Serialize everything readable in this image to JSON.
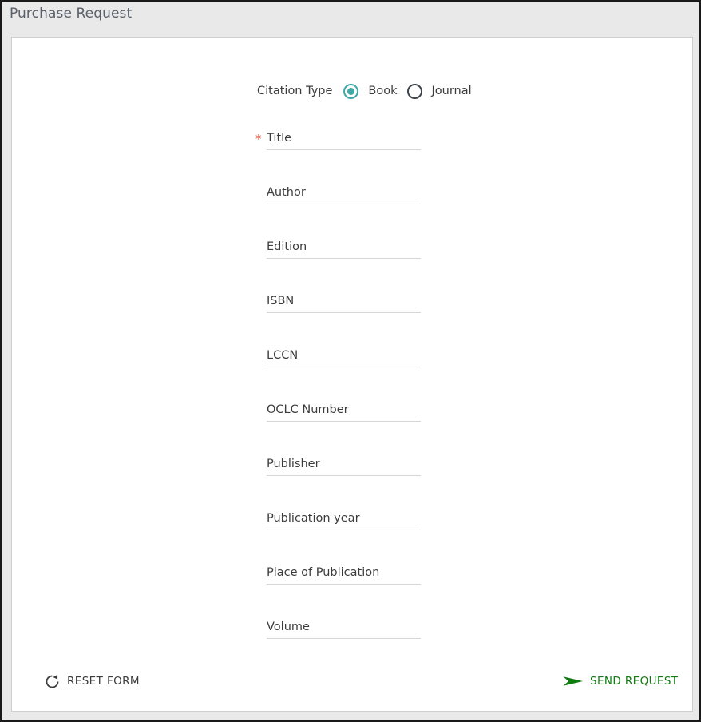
{
  "window": {
    "title": "Purchase Request"
  },
  "form": {
    "citation_type": {
      "label": "Citation Type",
      "options": [
        {
          "label": "Book",
          "selected": true,
          "icon": "radio-selected-icon"
        },
        {
          "label": "Journal",
          "selected": false,
          "icon": "radio-unselected-icon"
        }
      ]
    },
    "required_marker": "*",
    "fields": [
      {
        "name": "title",
        "label": "Title",
        "value": "",
        "required": true
      },
      {
        "name": "author",
        "label": "Author",
        "value": "",
        "required": false
      },
      {
        "name": "edition",
        "label": "Edition",
        "value": "",
        "required": false
      },
      {
        "name": "isbn",
        "label": "ISBN",
        "value": "",
        "required": false
      },
      {
        "name": "lccn",
        "label": "LCCN",
        "value": "",
        "required": false
      },
      {
        "name": "oclc-number",
        "label": "OCLC Number",
        "value": "",
        "required": false
      },
      {
        "name": "publisher",
        "label": "Publisher",
        "value": "",
        "required": false
      },
      {
        "name": "publication-year",
        "label": "Publication year",
        "value": "",
        "required": false
      },
      {
        "name": "place-of-publication",
        "label": "Place of Publication",
        "value": "",
        "required": false
      },
      {
        "name": "volume",
        "label": "Volume",
        "value": "",
        "required": false
      }
    ],
    "actions": {
      "reset": {
        "label": "RESET FORM",
        "icon": "refresh-circular-arrow-icon"
      },
      "send": {
        "label": "SEND REQUEST",
        "icon": "send-arrow-icon"
      }
    }
  },
  "colors": {
    "accent_teal": "#3fa9a6",
    "required_star": "#f4694b",
    "send_green": "#107c10",
    "text": "#3c3c3c",
    "title_text": "#5a6069",
    "header_bg": "#e9e9e9",
    "field_underline": "#d6d6d6",
    "panel_border": "#cfcfcf",
    "window_border": "#1a1a1a"
  }
}
